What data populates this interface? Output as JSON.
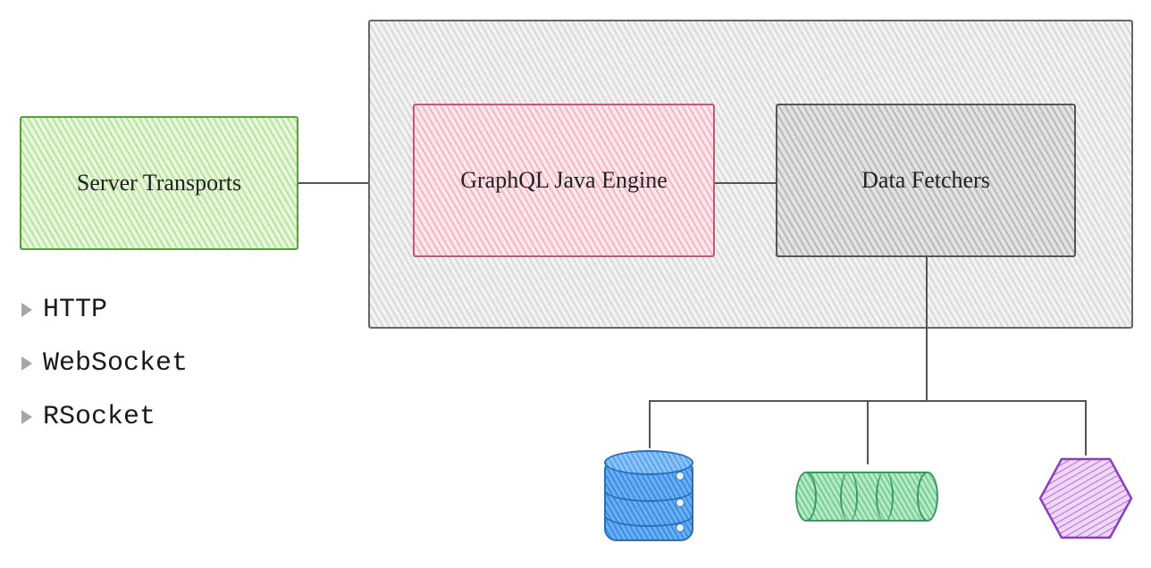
{
  "boxes": {
    "server_transports": "Server Transports",
    "graphql_engine": "GraphQL Java Engine",
    "data_fetchers": "Data Fetchers"
  },
  "transports_list": [
    "HTTP",
    "WebSocket",
    "RSocket"
  ],
  "colors": {
    "green_box": "#b7e39b",
    "pink_box": "#f3b6c4",
    "gray_box": "#d8d8d8",
    "db_blue": "#3a8ee6",
    "queue_green": "#77cf96",
    "hex_purple": "#b46adf"
  },
  "data_sources": {
    "database": "database-cylinder",
    "queue": "message-queue",
    "service": "hexagon-service"
  }
}
